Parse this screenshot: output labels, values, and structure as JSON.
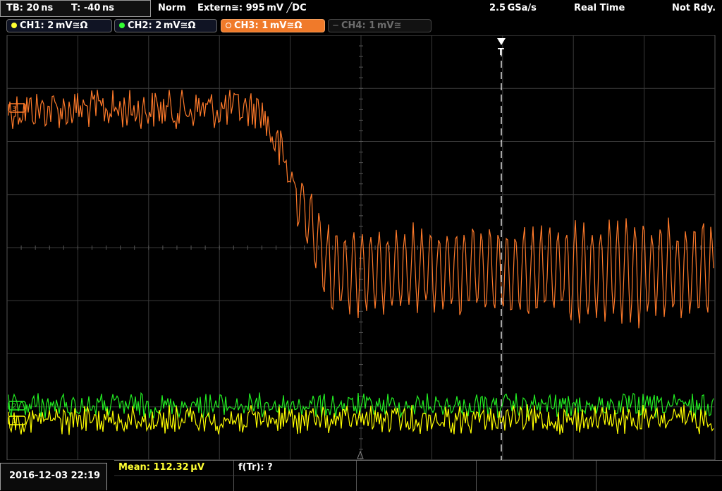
{
  "header": {
    "timebase": "TB: 20 ns",
    "trigger_time": "T: -40 ns",
    "mode": "Norm",
    "trigger_source": "Extern≅: 995 mV ╱DC",
    "sample_rate": "2.5 GSa/s",
    "acq_mode": "Real Time",
    "state": "Not Rdy."
  },
  "channels": [
    {
      "id": "ch1",
      "label": "CH1: 2 mV≅Ω",
      "color": "#ffff33",
      "active": false,
      "enabled": true
    },
    {
      "id": "ch2",
      "label": "CH2: 2 mV≅Ω",
      "color": "#33ff33",
      "active": false,
      "enabled": true
    },
    {
      "id": "ch3",
      "label": "CH3: 1 mV≅Ω",
      "color": "#ff8a3d",
      "active": true,
      "enabled": true
    },
    {
      "id": "ch4",
      "label": "CH4: 1 mV≅",
      "color": "#6d6d6d",
      "active": false,
      "enabled": false
    }
  ],
  "markers": {
    "trigger_label": "T",
    "ch3_ref": "3",
    "ch2_ref": "2",
    "ch1_ref": "1"
  },
  "colors": {
    "grid": "#3a3a3a",
    "ch1": "#ffff00",
    "ch2": "#22ee22",
    "ch3": "#ff7a2a",
    "trigger_line": "#ffffff"
  },
  "footer": {
    "datetime": "2016-12-03 22:19",
    "meas1": "Mean: 112.32 µV",
    "meas2": "f(Tr): ?"
  }
}
